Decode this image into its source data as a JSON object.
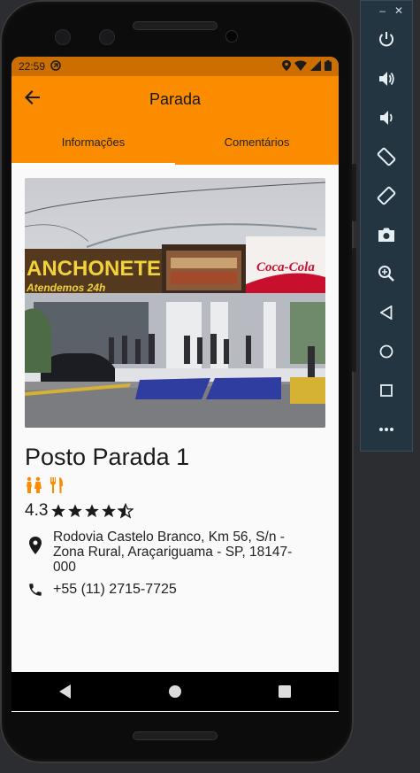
{
  "status_bar": {
    "time": "22:59"
  },
  "app_bar": {
    "title": "Parada",
    "back_icon": "arrow-back-icon"
  },
  "tabs": [
    {
      "label": "Informações",
      "active": true
    },
    {
      "label": "Comentários",
      "active": false
    }
  ],
  "place": {
    "name": "Posto Parada 1",
    "amenities": [
      "restroom-icon",
      "restaurant-icon"
    ],
    "rating": "4.3",
    "rating_value": 4.3,
    "address": "Rodovia Castelo Branco, Km 56, S/n - Zona Rural, Araçariguama - SP, 18147-000",
    "phone": "+55 (11) 2715-7725",
    "photo": {
      "sign_text": "ANCHONETE",
      "sign_subtext": "Atendemos 24h",
      "ad_text": "Coca-Cola"
    }
  },
  "colors": {
    "primary": "#fb8c00",
    "status_bar": "#cc6e00",
    "background": "#fafafa"
  },
  "emulator_toolbar": {
    "buttons": [
      "power-icon",
      "volume-up-icon",
      "volume-down-icon",
      "rotate-left-icon",
      "rotate-right-icon",
      "camera-icon",
      "zoom-icon",
      "back-icon",
      "home-icon",
      "overview-icon",
      "more-icon"
    ]
  }
}
